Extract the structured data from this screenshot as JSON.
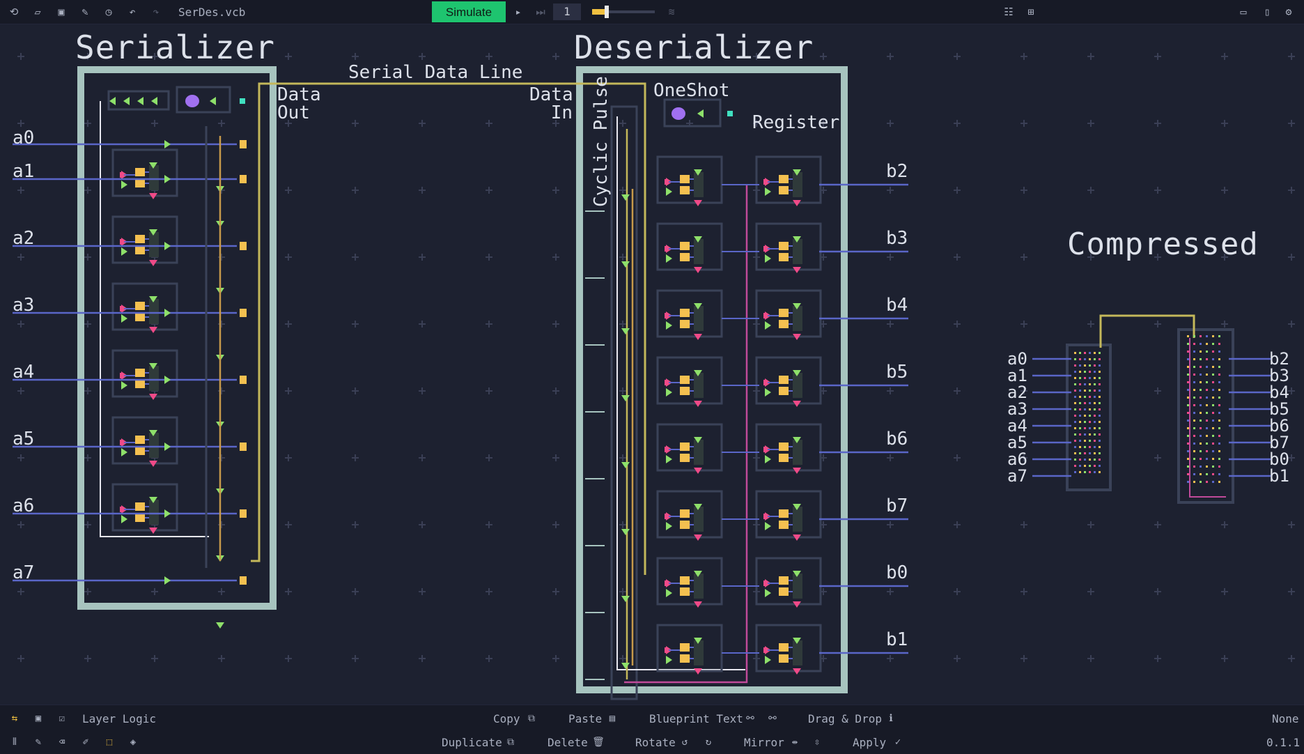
{
  "toolbar": {
    "left_icons": [
      "new-file-icon",
      "open-folder-icon",
      "save-icon",
      "save-as-icon",
      "history-icon",
      "undo-icon",
      "redo-icon"
    ],
    "filename": "SerDes.vcb",
    "simulate_label": "Simulate",
    "tick_value": "1",
    "speed_level": 0.2,
    "right_icons": [
      "align-icon",
      "group-icon",
      "window-icon",
      "book-icon",
      "gear-icon"
    ]
  },
  "canvas": {
    "serializer_title": "Serializer",
    "deserializer_title": "Deserializer",
    "serial_line_label": "Serial Data Line",
    "data_out_label": [
      "Data",
      "Out"
    ],
    "data_in_label": [
      "Data",
      "In"
    ],
    "oneshot_label": "OneShot",
    "register_label": "Register",
    "cyclic_pulse_label": "Cyclic Pulse",
    "compressed_title": "Compressed",
    "inputs": [
      "a0",
      "a1",
      "a2",
      "a3",
      "a4",
      "a5",
      "a6",
      "a7"
    ],
    "outputs": [
      "b2",
      "b3",
      "b4",
      "b5",
      "b6",
      "b7",
      "b0",
      "b1"
    ],
    "compressed_inputs": [
      "a0",
      "a1",
      "a2",
      "a3",
      "a4",
      "a5",
      "a6",
      "a7"
    ],
    "compressed_outputs": [
      "b2",
      "b3",
      "b4",
      "b5",
      "b6",
      "b7",
      "b0",
      "b1"
    ]
  },
  "colors": {
    "background": "#1d2130",
    "frame": "#a7c4bf",
    "wire_blue": "#5a66c8",
    "wire_yellow": "#c4b85a",
    "wire_orange": "#c89a4a",
    "wire_teal": "#4aa0b8",
    "wire_pink": "#c04a9a",
    "gate_yellow": "#f4c050",
    "gate_green": "#8ee06a",
    "gate_pink": "#f04a88",
    "gate_purple": "#a070f0",
    "simulate_green": "#1ec46f"
  },
  "bottombar": {
    "mode_label": "Layer Logic",
    "copy_label": "Copy",
    "paste_label": "Paste",
    "blueprint_label": "Blueprint Text",
    "dragdrop_label": "Drag & Drop",
    "none_label": "None",
    "duplicate_label": "Duplicate",
    "delete_label": "Delete",
    "rotate_label": "Rotate",
    "mirror_label": "Mirror",
    "apply_label": "Apply",
    "version": "0.1.1"
  }
}
